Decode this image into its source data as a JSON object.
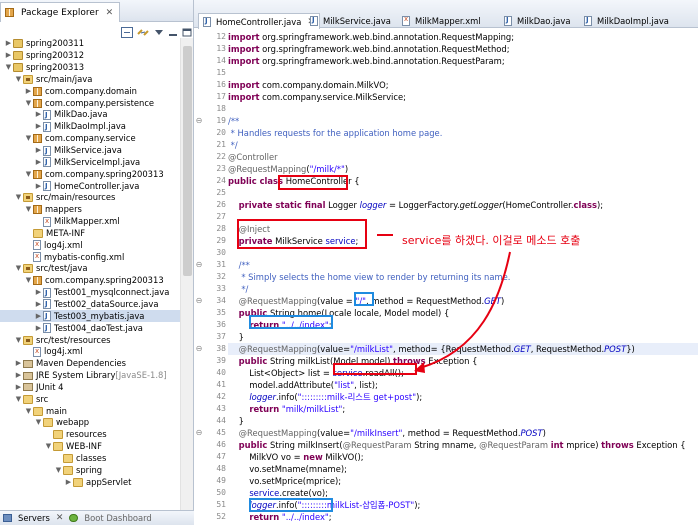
{
  "explorer": {
    "title": "Package Explorer",
    "tab_close": "✕",
    "items": [
      {
        "label": "spring200311",
        "level": 0,
        "icon": "project",
        "toggle": "▶"
      },
      {
        "label": "spring200312",
        "level": 0,
        "icon": "project",
        "toggle": "▶"
      },
      {
        "label": "spring200313",
        "level": 0,
        "icon": "project",
        "toggle": "▼"
      },
      {
        "label": "src/main/java",
        "level": 1,
        "icon": "srcfolder",
        "toggle": "▼"
      },
      {
        "label": "com.company.domain",
        "level": 2,
        "icon": "pkg",
        "toggle": "▶"
      },
      {
        "label": "com.company.persistence",
        "level": 2,
        "icon": "pkg",
        "toggle": "▼"
      },
      {
        "label": "MilkDao.java",
        "level": 3,
        "icon": "java",
        "toggle": "▶"
      },
      {
        "label": "MilkDaoImpl.java",
        "level": 3,
        "icon": "java",
        "toggle": "▶"
      },
      {
        "label": "com.company.service",
        "level": 2,
        "icon": "pkg",
        "toggle": "▼"
      },
      {
        "label": "MilkService.java",
        "level": 3,
        "icon": "java",
        "toggle": "▶"
      },
      {
        "label": "MilkServiceImpl.java",
        "level": 3,
        "icon": "java",
        "toggle": "▶"
      },
      {
        "label": "com.company.spring200313",
        "level": 2,
        "icon": "pkg",
        "toggle": "▼"
      },
      {
        "label": "HomeController.java",
        "level": 3,
        "icon": "java",
        "toggle": "▶"
      },
      {
        "label": "src/main/resources",
        "level": 1,
        "icon": "srcfolder",
        "toggle": "▼"
      },
      {
        "label": "mappers",
        "level": 2,
        "icon": "pkg",
        "toggle": "▼"
      },
      {
        "label": "MilkMapper.xml",
        "level": 3,
        "icon": "xml",
        "toggle": ""
      },
      {
        "label": "META-INF",
        "level": 2,
        "icon": "folder",
        "toggle": ""
      },
      {
        "label": "log4j.xml",
        "level": 2,
        "icon": "xml",
        "toggle": ""
      },
      {
        "label": "mybatis-config.xml",
        "level": 2,
        "icon": "xml",
        "toggle": ""
      },
      {
        "label": "src/test/java",
        "level": 1,
        "icon": "srcfolder",
        "toggle": "▼"
      },
      {
        "label": "com.company.spring200313",
        "level": 2,
        "icon": "pkg",
        "toggle": "▼"
      },
      {
        "label": "Test001_mysqlconnect.java",
        "level": 3,
        "icon": "java",
        "toggle": "▶"
      },
      {
        "label": "Test002_dataSource.java",
        "level": 3,
        "icon": "java",
        "toggle": "▶"
      },
      {
        "label": "Test003_mybatis.java",
        "level": 3,
        "icon": "java",
        "toggle": "▶",
        "selected": true
      },
      {
        "label": "Test004_daoTest.java",
        "level": 3,
        "icon": "java",
        "toggle": "▶"
      },
      {
        "label": "src/test/resources",
        "level": 1,
        "icon": "srcfolder",
        "toggle": "▼"
      },
      {
        "label": "log4j.xml",
        "level": 2,
        "icon": "xml",
        "toggle": ""
      },
      {
        "label": "Maven Dependencies",
        "level": 1,
        "icon": "lib",
        "toggle": "▶"
      },
      {
        "label": "JRE System Library",
        "suffix": " [JavaSE-1.8]",
        "level": 1,
        "icon": "lib",
        "toggle": "▶"
      },
      {
        "label": "JUnit 4",
        "level": 1,
        "icon": "lib",
        "toggle": "▶"
      },
      {
        "label": "src",
        "level": 1,
        "icon": "folder",
        "toggle": "▼"
      },
      {
        "label": "main",
        "level": 2,
        "icon": "folder",
        "toggle": "▼"
      },
      {
        "label": "webapp",
        "level": 3,
        "icon": "folder",
        "toggle": "▼"
      },
      {
        "label": "resources",
        "level": 4,
        "icon": "folder",
        "toggle": ""
      },
      {
        "label": "WEB-INF",
        "level": 4,
        "icon": "folder",
        "toggle": "▼"
      },
      {
        "label": "classes",
        "level": 5,
        "icon": "folder",
        "toggle": ""
      },
      {
        "label": "spring",
        "level": 5,
        "icon": "folder",
        "toggle": "▼"
      },
      {
        "label": "appServlet",
        "level": 6,
        "icon": "folder",
        "toggle": "▶"
      }
    ]
  },
  "bottom_tabs": {
    "servers": "Servers",
    "servers_close": "✕",
    "boot": "Boot Dashboard"
  },
  "editor": {
    "tabs": [
      {
        "label": "HomeController.java",
        "icon": "java",
        "active": true,
        "close": "✕"
      },
      {
        "label": "MilkService.java",
        "icon": "java"
      },
      {
        "label": "MilkMapper.xml",
        "icon": "xml"
      },
      {
        "label": "MilkDao.java",
        "icon": "java"
      },
      {
        "label": "MilkDaoImpl.java",
        "icon": "java"
      }
    ],
    "lines": [
      {
        "n": "12",
        "t": [
          {
            "c": "kw",
            "s": "import"
          },
          {
            "s": " org.springframework.web.bind.annotation.RequestMapping;"
          }
        ]
      },
      {
        "n": "13",
        "t": [
          {
            "c": "kw",
            "s": "import"
          },
          {
            "s": " org.springframework.web.bind.annotation.RequestMethod;"
          }
        ]
      },
      {
        "n": "14",
        "t": [
          {
            "c": "kw",
            "s": "import"
          },
          {
            "s": " org.springframework.web.bind.annotation.RequestParam;"
          }
        ]
      },
      {
        "n": "15",
        "t": []
      },
      {
        "n": "16",
        "t": [
          {
            "c": "kw",
            "s": "import"
          },
          {
            "s": " com.company.domain.MilkVO;"
          }
        ]
      },
      {
        "n": "17",
        "t": [
          {
            "c": "kw",
            "s": "import"
          },
          {
            "s": " com.company.service.MilkService;"
          }
        ]
      },
      {
        "n": "18",
        "t": []
      },
      {
        "n": "19",
        "fold": "⊖",
        "t": [
          {
            "c": "cm",
            "s": "/**"
          }
        ]
      },
      {
        "n": "20",
        "t": [
          {
            "c": "cm",
            "s": " * Handles requests for the application home page."
          }
        ]
      },
      {
        "n": "21",
        "t": [
          {
            "c": "cm",
            "s": " */"
          }
        ]
      },
      {
        "n": "22",
        "t": [
          {
            "c": "an",
            "s": "@Controller"
          }
        ]
      },
      {
        "n": "23",
        "t": [
          {
            "c": "an",
            "s": "@RequestMapping"
          },
          {
            "s": "("
          },
          {
            "c": "str",
            "s": "\"/milk/*\""
          },
          {
            "s": ")"
          }
        ]
      },
      {
        "n": "24",
        "t": [
          {
            "c": "kw",
            "s": "public class"
          },
          {
            "s": " HomeController {"
          }
        ]
      },
      {
        "n": "25",
        "t": []
      },
      {
        "n": "26",
        "t": [
          {
            "s": "    "
          },
          {
            "c": "kw",
            "s": "private static final"
          },
          {
            "s": " Logger "
          },
          {
            "c": "fld",
            "s": "logger"
          },
          {
            "s": " = LoggerFactory."
          },
          {
            "c": "ital",
            "s": "getLogger"
          },
          {
            "s": "(HomeController."
          },
          {
            "c": "kw",
            "s": "class"
          },
          {
            "s": ");"
          }
        ]
      },
      {
        "n": "27",
        "t": []
      },
      {
        "n": "28",
        "t": [
          {
            "s": "    "
          },
          {
            "c": "an",
            "s": "@Inject"
          }
        ]
      },
      {
        "n": "29",
        "t": [
          {
            "s": "    "
          },
          {
            "c": "kw",
            "s": "private"
          },
          {
            "s": " MilkService "
          },
          {
            "c": "fldp",
            "s": "service"
          },
          {
            "s": ";"
          }
        ]
      },
      {
        "n": "30",
        "t": []
      },
      {
        "n": "31",
        "fold": "⊖",
        "t": [
          {
            "s": "    "
          },
          {
            "c": "cm",
            "s": "/**"
          }
        ]
      },
      {
        "n": "32",
        "t": [
          {
            "s": "    "
          },
          {
            "c": "cm",
            "s": " * Simply selects the home view to render by returning its name."
          }
        ]
      },
      {
        "n": "33",
        "t": [
          {
            "s": "    "
          },
          {
            "c": "cm",
            "s": " */"
          }
        ]
      },
      {
        "n": "34",
        "fold": "⊖",
        "t": [
          {
            "s": "    "
          },
          {
            "c": "an",
            "s": "@RequestMapping"
          },
          {
            "s": "(value = "
          },
          {
            "c": "str",
            "s": "\"/\""
          },
          {
            "s": ", method = RequestMethod."
          },
          {
            "c": "fld",
            "s": "GET"
          },
          {
            "s": ")"
          }
        ]
      },
      {
        "n": "35",
        "t": [
          {
            "s": "    "
          },
          {
            "c": "kw",
            "s": "public"
          },
          {
            "s": " String home(Locale locale, Model model) {"
          }
        ]
      },
      {
        "n": "36",
        "t": [
          {
            "s": "        "
          },
          {
            "c": "kw",
            "s": "return"
          },
          {
            "s": " "
          },
          {
            "c": "str",
            "s": "\"../../index\""
          },
          {
            "s": ";"
          }
        ]
      },
      {
        "n": "37",
        "t": [
          {
            "s": "    }"
          }
        ]
      },
      {
        "n": "38",
        "fold": "⊖",
        "hl": true,
        "t": [
          {
            "s": "    "
          },
          {
            "c": "an",
            "s": "@RequestMapping"
          },
          {
            "s": "(value="
          },
          {
            "c": "str",
            "s": "\"/milkList\""
          },
          {
            "s": ", method= {RequestMethod."
          },
          {
            "c": "fld",
            "s": "GET"
          },
          {
            "s": ", RequestMethod."
          },
          {
            "c": "fld",
            "s": "POST"
          },
          {
            "s": "})"
          }
        ]
      },
      {
        "n": "39",
        "t": [
          {
            "s": "    "
          },
          {
            "c": "kw",
            "s": "public"
          },
          {
            "s": " String milkList(Model model) "
          },
          {
            "c": "kw",
            "s": "throws"
          },
          {
            "s": " Exception {"
          }
        ]
      },
      {
        "n": "40",
        "t": [
          {
            "s": "        List<Object> list = "
          },
          {
            "c": "fldp",
            "s": "service"
          },
          {
            "s": ".readAll();"
          }
        ]
      },
      {
        "n": "41",
        "t": [
          {
            "s": "        model.addAttribute("
          },
          {
            "c": "str",
            "s": "\"list\""
          },
          {
            "s": ", list);"
          }
        ]
      },
      {
        "n": "42",
        "t": [
          {
            "s": "        "
          },
          {
            "c": "fld",
            "s": "logger"
          },
          {
            "s": ".info("
          },
          {
            "c": "str",
            "s": "\":::::::::milk-리스트 get+post\""
          },
          {
            "s": ");"
          }
        ]
      },
      {
        "n": "43",
        "t": [
          {
            "s": "        "
          },
          {
            "c": "kw",
            "s": "return"
          },
          {
            "s": " "
          },
          {
            "c": "str",
            "s": "\"milk/milkList\""
          },
          {
            "s": ";"
          }
        ]
      },
      {
        "n": "44",
        "t": [
          {
            "s": "    }"
          }
        ]
      },
      {
        "n": "45",
        "fold": "⊖",
        "t": [
          {
            "s": "    "
          },
          {
            "c": "an",
            "s": "@RequestMapping"
          },
          {
            "s": "(value="
          },
          {
            "c": "str",
            "s": "\"/milkInsert\""
          },
          {
            "s": ", method = RequestMethod."
          },
          {
            "c": "fld",
            "s": "POST"
          },
          {
            "s": ")"
          }
        ]
      },
      {
        "n": "46",
        "t": [
          {
            "s": "    "
          },
          {
            "c": "kw",
            "s": "public"
          },
          {
            "s": " String milkInsert("
          },
          {
            "c": "an",
            "s": "@RequestParam"
          },
          {
            "s": " String mname, "
          },
          {
            "c": "an",
            "s": "@RequestParam"
          },
          {
            "s": " "
          },
          {
            "c": "kw",
            "s": "int"
          },
          {
            "s": " mprice) "
          },
          {
            "c": "kw",
            "s": "throws"
          },
          {
            "s": " Exception {"
          }
        ]
      },
      {
        "n": "47",
        "t": [
          {
            "s": "        MilkVO vo = "
          },
          {
            "c": "kw",
            "s": "new"
          },
          {
            "s": " MilkVO();"
          }
        ]
      },
      {
        "n": "48",
        "t": [
          {
            "s": "        vo.setMname(mname);"
          }
        ]
      },
      {
        "n": "49",
        "t": [
          {
            "s": "        vo.setMprice(mprice);"
          }
        ]
      },
      {
        "n": "50",
        "t": [
          {
            "s": "        "
          },
          {
            "c": "fldp",
            "s": "service"
          },
          {
            "s": ".create(vo);"
          }
        ]
      },
      {
        "n": "51",
        "t": [
          {
            "s": "        "
          },
          {
            "c": "fld",
            "s": "logger"
          },
          {
            "s": ".info("
          },
          {
            "c": "str",
            "s": "\":::::::::milkList-삽입폼-POST\""
          },
          {
            "s": ");"
          }
        ]
      },
      {
        "n": "52",
        "t": [
          {
            "s": "        "
          },
          {
            "c": "kw",
            "s": "return"
          },
          {
            "s": " "
          },
          {
            "c": "str",
            "s": "\"../../index\""
          },
          {
            "s": ";"
          }
        ]
      },
      {
        "n": "53",
        "t": [
          {
            "s": "    }"
          }
        ]
      }
    ]
  },
  "annotation": {
    "note": "service를 하겠다. 이걸로 메소드 호출",
    "color_red": "#e60012",
    "color_blue": "#1f8be0"
  }
}
